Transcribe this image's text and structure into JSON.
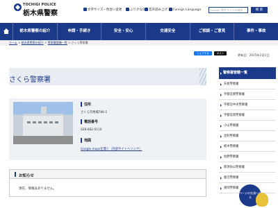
{
  "header": {
    "logo_en": "TOCHIGI POLICE",
    "logo_ja": "栃木県警察",
    "util": [
      "文字サイズ・色合い変更",
      "ふりがなON",
      "音声読み上げ",
      "Foreign Language"
    ],
    "search_placeholder": "Google 提供 サイト内検索",
    "search_button": "検 索"
  },
  "nav": {
    "items": [
      "栃木県警察の紹介",
      "申請・手続き",
      "安全・安心",
      "交通安全",
      "ご相談・ご意見",
      "事件・事故"
    ]
  },
  "breadcrumb": {
    "items": [
      "ホーム",
      "栃木県警察の紹介",
      "警察署管轄一覧"
    ],
    "current": "さくら警察署",
    "separator": ">"
  },
  "sns": {
    "share": "シェアする",
    "post": "ポスト"
  },
  "updated": "更新日：2025年2月1日",
  "page_title": "さくら警察署",
  "info": {
    "address_label": "住所",
    "address": "さくら市馬場786-1",
    "phone_label": "電話番号",
    "phone": "028-682-0110",
    "map_label": "地図",
    "map_link": "Google mapsを開く（外部サイトへリンク）"
  },
  "notice": {
    "title": "お知らせ",
    "body": "現在、情報はありません。"
  },
  "sidebar": {
    "title": "警察署管轄一覧",
    "items": [
      "矢板警察署",
      "宇都宮東警察署",
      "宇都宮中央警察署",
      "宇都宮南警察署",
      "小山警察署",
      "足利警察署",
      "栃木警察署",
      "佐野警察署",
      "那須烏山警察署",
      "鹿沼警察署",
      "真岡警察署"
    ]
  },
  "pagetop": "ページの先頭へ戻る",
  "colors": {
    "primary": "#1b3a8a",
    "facebook": "#1877f2",
    "x": "#111111"
  }
}
